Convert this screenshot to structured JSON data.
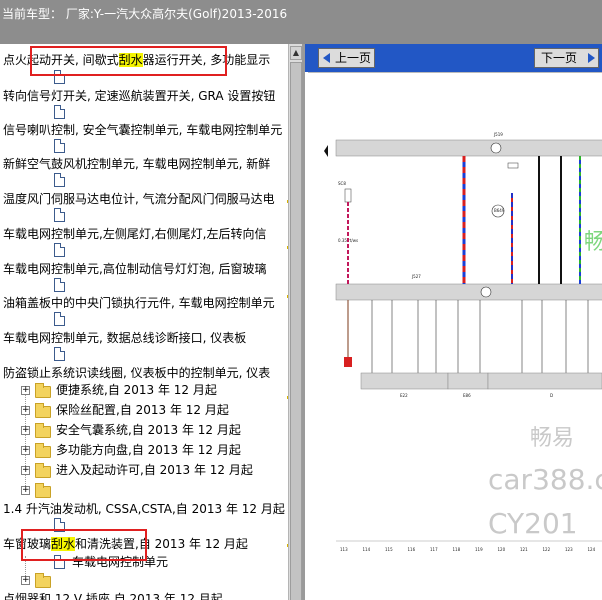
{
  "title": {
    "prefix": "当前车型：",
    "model": "厂家:Y-一汽大众高尔夫(Golf)2013-2016"
  },
  "tree": {
    "rows": [
      {
        "text": "点火起动开关, 间歇式",
        "hl": "刮水",
        "after": "器运行开关, 多功能显示"
      },
      {
        "text": "转向信号灯开关, 定速巡航装置开关, GRA 设置按钮"
      },
      {
        "text": "信号喇叭控制, 安全气囊控制单元, 车载电网控制单元"
      },
      {
        "text": "新鲜空气鼓风机控制单元, 车载电网控制单元, 新鲜"
      },
      {
        "text": "温度风门伺服马达电位计, 气流分配风门伺服马达电"
      },
      {
        "text": "车载电网控制单元,左侧尾灯,右侧尾灯,左后转向信"
      },
      {
        "text": "车载电网控制单元,高位制动信号灯灯泡, 后窗玻璃"
      },
      {
        "text": "油箱盖板中的中央门锁执行元件, 车载电网控制单元"
      },
      {
        "text": "车载电网控制单元, 数据总线诊断接口, 仪表板"
      },
      {
        "text": "防盗锁止系统识读线圈, 仪表板中的控制单元, 仪表"
      }
    ],
    "folders": [
      {
        "text": "便捷系统,自 2013 年 12 月起"
      },
      {
        "text": "保险丝配置,自 2013 年 12 月起"
      },
      {
        "text": "安全气囊系统,自 2013 年 12 月起"
      },
      {
        "text": "多功能方向盘,自 2013 年 12 月起"
      },
      {
        "text": "进入及起动许可,自 2013 年 12 月起"
      }
    ],
    "engine_row": {
      "text": "1.4 升汽油发动机, CSSA,CSTA,自 2013 年 12 月起"
    },
    "wiper_row": {
      "pre": "车窗玻璃",
      "hl": "刮水",
      "post": "和清洗装置,自 2013 年 12 月起"
    },
    "child_row": {
      "text": "车载电网控制单元"
    },
    "last_row": {
      "text": "点烟器和 12 V 插座,自 2013 年 12 月起"
    }
  },
  "nav": {
    "prev": "上一页",
    "next": "下一页"
  },
  "diagram": {
    "top_label": "J519",
    "mid_label": "J527",
    "left_label": "SC8",
    "left_wire_label": "0.35 rt/ws",
    "mid_ring_label": "B649",
    "bottom_components": [
      "E22",
      "E86",
      "D"
    ],
    "scale_numbers": [
      "113",
      "114",
      "115",
      "116",
      "117",
      "118",
      "119",
      "120",
      "121",
      "122",
      "123",
      "124"
    ],
    "watermark": {
      "line1": "畅易",
      "line2": "car388.c",
      "line3": "CY201",
      "green": "畅"
    }
  },
  "colors": {
    "accent_red": "#e02020",
    "highlight": "#f4f400",
    "nav_blue": "#2257c5",
    "titlebar": "#8d8d8d"
  }
}
